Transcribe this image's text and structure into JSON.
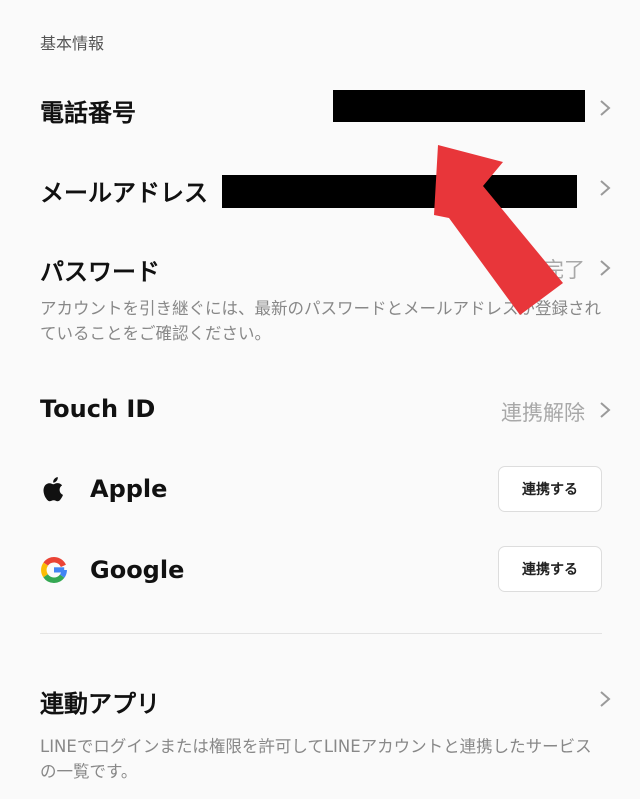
{
  "section": {
    "title": "基本情報"
  },
  "phone": {
    "label": "電話番号"
  },
  "email": {
    "label": "メールアドレス"
  },
  "password": {
    "label": "パスワード",
    "status": "登録完了",
    "note": "アカウントを引き継ぐには、最新のパスワードとメールアドレスが登録されていることをご確認ください。"
  },
  "touch_id": {
    "label": "Touch ID",
    "status": "連携解除"
  },
  "apple": {
    "label": "Apple",
    "button": "連携する",
    "icon": "apple-icon"
  },
  "google": {
    "label": "Google",
    "button": "連携する",
    "icon": "google-icon"
  },
  "linked_apps": {
    "label": "連動アプリ",
    "note": "LINEでログインまたは権限を許可してLINEアカウントと連携したサービスの一覧です。"
  },
  "colors": {
    "arrow": "#e8363a",
    "redaction": "#000000",
    "muted": "#a8a8a8"
  }
}
